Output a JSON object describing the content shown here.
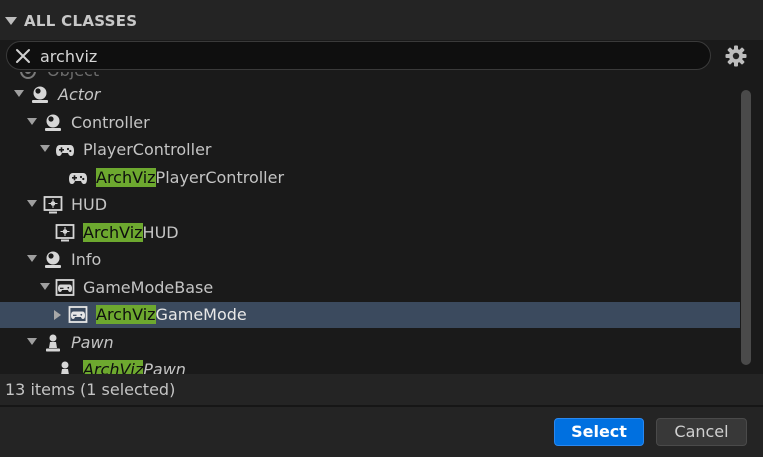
{
  "header": {
    "title": "ALL CLASSES"
  },
  "search": {
    "value": "archviz"
  },
  "tree": {
    "rows": [
      {
        "label": "Object",
        "match": ""
      },
      {
        "label": "Actor",
        "match": ""
      },
      {
        "label": "Controller",
        "match": ""
      },
      {
        "label": "PlayerController",
        "match": ""
      },
      {
        "label": "PlayerController",
        "match": "ArchViz"
      },
      {
        "label": "HUD",
        "match": ""
      },
      {
        "label": "HUD",
        "match": "ArchViz"
      },
      {
        "label": "Info",
        "match": ""
      },
      {
        "label": "GameModeBase",
        "match": ""
      },
      {
        "label": "GameMode",
        "match": "ArchViz"
      },
      {
        "label": "Pawn",
        "match": ""
      },
      {
        "label": "Pawn",
        "match": "ArchViz"
      }
    ]
  },
  "footer": {
    "status": "13 items (1 selected)",
    "select_label": "Select",
    "cancel_label": "Cancel"
  },
  "colors": {
    "highlight": "#6da82f",
    "selected_row": "#3b4a5e",
    "primary_button": "#0070e0"
  }
}
